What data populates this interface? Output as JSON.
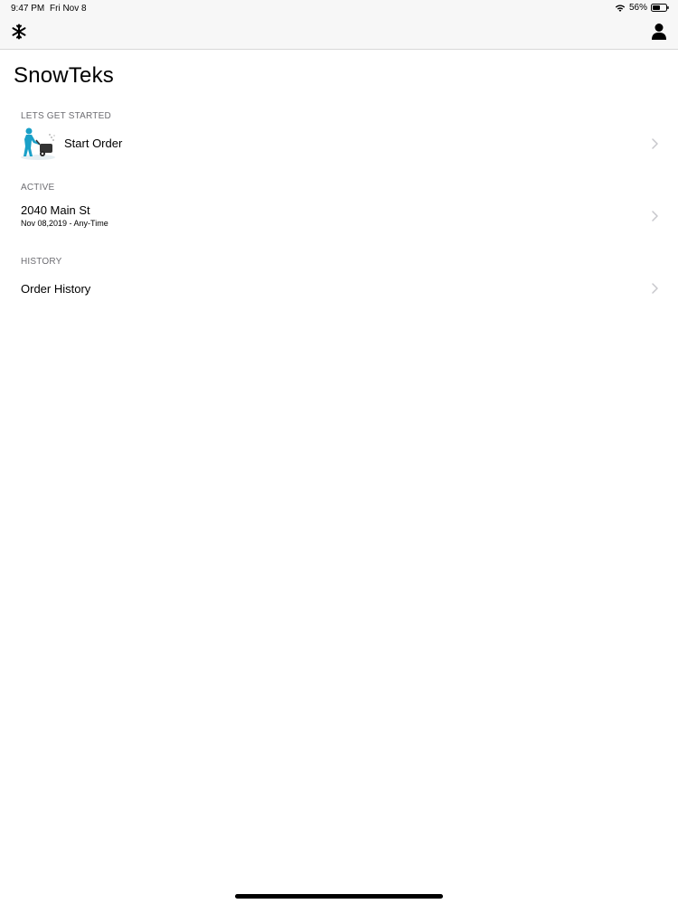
{
  "status_bar": {
    "time": "9:47 PM",
    "date": "Fri Nov 8",
    "battery": "56%"
  },
  "nav": {
    "left_icon": "snowflake-icon",
    "right_icon": "person-icon"
  },
  "title": "SnowTeks",
  "sections": {
    "start": {
      "header": "LETS GET STARTED",
      "item_label": "Start Order",
      "item_icon": "snowblower-person-icon"
    },
    "active": {
      "header": "ACTIVE",
      "item_title": "2040 Main St",
      "item_subtitle": "Nov 08,2019 - Any-Time"
    },
    "history": {
      "header": "HISTORY",
      "item_label": "Order History"
    }
  },
  "colors": {
    "bar_bg": "#f7f7f7",
    "section_text": "#6d6d72",
    "chevron": "#c7c7cc",
    "illustration_accent": "#1aa0c8"
  }
}
